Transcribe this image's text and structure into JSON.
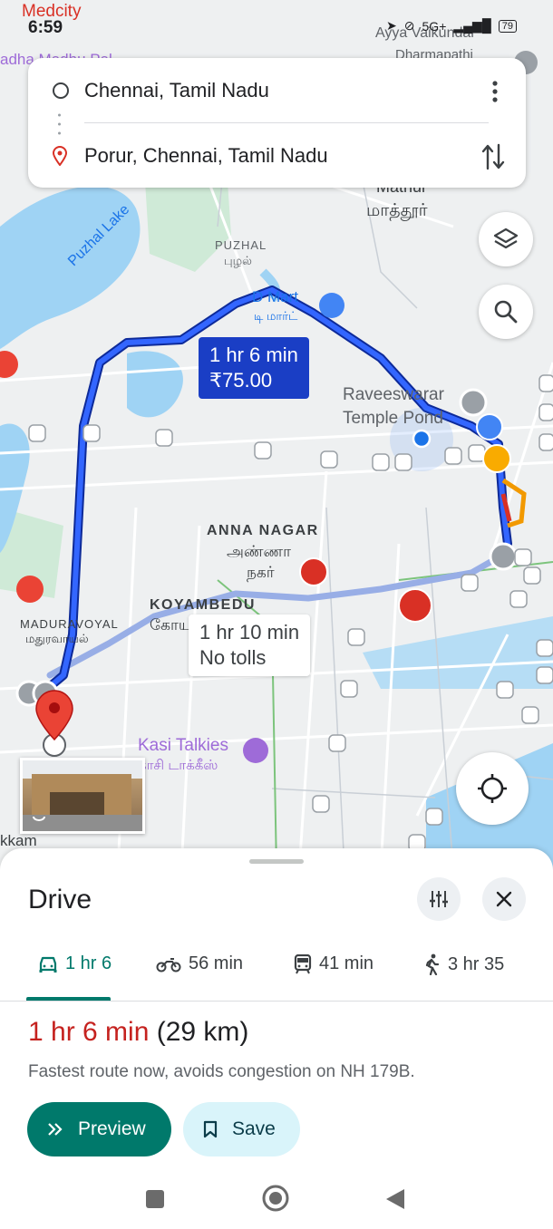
{
  "status_bar": {
    "time": "6:59",
    "carrier": "Medcity",
    "network": "5G+",
    "battery": "79"
  },
  "search": {
    "origin": "Chennai, Tamil Nadu",
    "destination": "Porur, Chennai, Tamil Nadu"
  },
  "map": {
    "labels": {
      "mathur_en": "Mathur",
      "mathur_ta": "மாத்தூர்",
      "puzhal_en": "PUZHAL",
      "puzhal_ta": "புழல்",
      "puzhal_lake": "Puzhal Lake",
      "dmart_en": "D Mart",
      "dmart_ta": "டி மார்ட்",
      "temple_1": "Raveeswarar",
      "temple_2": "Temple Pond",
      "anna_en": "ANNA NAGAR",
      "anna_ta1": "அண்ணா",
      "anna_ta2": "நகர்",
      "koyambedu_en": "KOYAMBEDU",
      "koyambedu_ta": "கோய",
      "maduravoyal_en": "MADURAVOYAL",
      "maduravoyal_ta": "மதுரவாயல்",
      "kasi_en": "Kasi Talkies",
      "kasi_ta": "காசி டாக்கீஸ்",
      "ayya": "Ayya Vaikundar",
      "dharmapathi": "Dharmapathi",
      "kkam": "kkam",
      "madhu": "adha Madhu Pal"
    },
    "route_primary": {
      "time": "1 hr 6 min",
      "toll": "₹75.00"
    },
    "route_alt": {
      "time": "1 hr 10 min",
      "toll": "No tolls"
    },
    "colors": {
      "route": "#1a3ec5",
      "alt_route": "#98aee6",
      "traffic_slow": "#f29900",
      "traffic_jam": "#d93025"
    }
  },
  "sheet": {
    "title": "Drive",
    "tabs": [
      {
        "icon": "car-icon",
        "label": "1 hr 6"
      },
      {
        "icon": "motorbike-icon",
        "label": "56 min"
      },
      {
        "icon": "train-icon",
        "label": "41 min"
      },
      {
        "icon": "walk-icon",
        "label": "3 hr 35"
      }
    ],
    "summary_time": "1 hr 6 min",
    "summary_distance": "(29 km)",
    "description": "Fastest route now, avoids congestion on NH 179B.",
    "preview_label": "Preview",
    "save_label": "Save"
  }
}
